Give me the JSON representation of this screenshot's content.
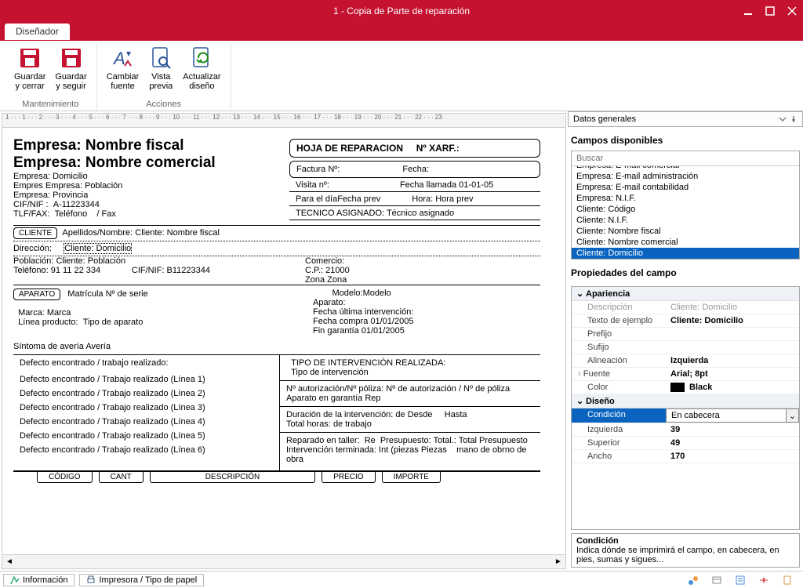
{
  "window": {
    "title": "1 - Copia de Parte de reparación"
  },
  "tabs": {
    "designer": "Diseñador"
  },
  "ribbon": {
    "groups": {
      "mantenimiento": {
        "label": "Mantenimiento",
        "save_close": "Guardar\ny cerrar",
        "save_continue": "Guardar\ny seguir"
      },
      "acciones": {
        "label": "Acciones",
        "change_font": "Cambiar\nfuente",
        "preview": "Vista\nprevia",
        "refresh": "Actualizar\ndiseño"
      }
    }
  },
  "ruler": "1 · · · 1 · · · 2 · · · 3 · · · 4 · · · 5 · · · 6 · · · 7 · · · 8 · · · 9 · · · 10 · · · 11 · · · 12 · · · 13 · · · 14 · · · 15 · · · 16 · · · 17 · · · 18 · · · 19 · · · 20 · · · 21 · · · 22 · · · 23",
  "report": {
    "company": {
      "fiscal": "Empresa: Nombre fiscal",
      "commercial": "Empresa: Nombre comercial",
      "domicilio": "Empresa: Domicilio",
      "poblacion": "Empres Empresa: Población",
      "provincia": "Empresa: Provincia",
      "cif_label": "CIF/NIF :",
      "cif_value": "A-11223344",
      "tlf_label": "TLF/FAX:",
      "tlf_value": "Teléfono",
      "fax_sep": "/ Fax"
    },
    "hoja": {
      "title": "HOJA DE REPARACION",
      "num": "Nº XARF.:"
    },
    "factura": {
      "num_label": "Factura Nº:",
      "fecha_label": "Fecha:"
    },
    "visita": {
      "num_label": "Visita nº:",
      "llamada_label": "Fecha llamada",
      "llamada_val": "01-01-05",
      "dia_label": "Para el día",
      "dia_val": "Fecha prev",
      "hora_label": "Hora:",
      "hora_val": "Hora prev",
      "tecnico_label": "TECNICO ASIGNADO:",
      "tecnico_val": "Técnico asignado"
    },
    "cliente": {
      "hdr": "CLIENTE",
      "nombre_label": "Apellidos/Nombre:",
      "nombre_val": "Cliente: Nombre fiscal",
      "dir_label": "Dirección:",
      "dir_val": "Cliente: Domicilio",
      "pob_label": "Población:",
      "pob_val": "Cliente: Población",
      "tel_label": "Teléfono:",
      "tel_val": "91 11 22 334",
      "cif_label": "CIF/NIF:",
      "cif_val": "B11223344",
      "right": {
        "comercio_label": "Comercio:",
        "cp_label": "C.P.:",
        "cp_val": "21000",
        "zona_label": "Zona",
        "zona_val": "Zona"
      }
    },
    "aparato": {
      "hdr": "APARATO",
      "matricula": "Matrícula Nº de serie",
      "modelo_l": "Modelo:",
      "modelo_v": "Modelo",
      "marca_l": "Marca:",
      "marca_v": "Marca",
      "aparato_l": "Aparato:",
      "linea_l": "Línea producto:",
      "linea_v": "Tipo de aparato",
      "ultima_l": "Fecha última intervención:",
      "compra_l": "Fecha compra",
      "compra_v": "01/01/2005",
      "fin_l": "Fin garantía",
      "fin_v": "01/01/2005",
      "sintoma_l": "Síntoma de avería",
      "sintoma_v": "Avería"
    },
    "defecto": {
      "defecto_hdr": "Defecto encontrado / trabajo realizado:",
      "tipo_hdr": "TIPO DE INTERVENCIÓN REALIZADA:",
      "tipo_val": "Tipo de intervención",
      "lines": [
        "Defecto encontrado / Trabajo realizado (Línea 1)",
        "Defecto encontrado / Trabajo realizado (Línea 2)",
        "Defecto encontrado / Trabajo realizado (Línea 3)",
        "Defecto encontrado / Trabajo realizado (Línea 4)",
        "Defecto encontrado / Trabajo realizado (Línea 5)",
        "Defecto encontrado / Trabajo realizado (Línea 6)"
      ],
      "auth_l": "Nº autorización/Nº póliza:",
      "auth_v": "Nº de autorización / Nº de póliza",
      "garantia_l": "Aparato en garantía",
      "garantia_v": "Rep",
      "dur_l": "Duración de la intervención:",
      "dur_v1": "de Desde",
      "dur_v2": "Hasta",
      "horas_l": "Total horas:",
      "horas_v": "de trabajo",
      "rep_l": "Reparado en taller:",
      "rep_v": "Re",
      "presu_l": "Presupuesto:",
      "presu_v": "Total.: Total Presupuesto",
      "term_l": "Intervención terminada:",
      "term_v": "Int (piezas Piezas",
      "term_v2": "mano de obrno de obra",
      "col_headers": [
        "CÓDIGO",
        "CANT",
        "DESCRIPCIÓN",
        "PRECIO",
        "IMPORTE"
      ]
    }
  },
  "panel": {
    "header": "Datos generales",
    "fields_title": "Campos disponibles",
    "search_placeholder": "Buscar",
    "fields": [
      "Empresa: E-mail comercial",
      "Empresa: E-mail administración",
      "Empresa: E-mail contabilidad",
      "Empresa: N.I.F.",
      "Cliente: Código",
      "Cliente: N.I.F.",
      "Cliente: Nombre fiscal",
      "Cliente: Nombre comercial",
      "Cliente: Domicilio"
    ],
    "fields_selected_index": 8,
    "props_title": "Propiedades del campo",
    "props": {
      "apariencia": "Apariencia",
      "descripcion_k": "Descripción",
      "descripcion_v": "Cliente: Domicilio",
      "ejemplo_k": "Texto de ejemplo",
      "ejemplo_v": "Cliente: Domicilio",
      "prefijo_k": "Prefijo",
      "sufijo_k": "Sufijo",
      "alineacion_k": "Alineación",
      "alineacion_v": "Izquierda",
      "fuente_k": "Fuente",
      "fuente_v": "Arial; 8pt",
      "color_k": "Color",
      "color_v": "Black",
      "diseno": "Diseño",
      "condicion_k": "Condición",
      "condicion_v": "En cabecera",
      "izquierda_k": "Izquierda",
      "izquierda_v": "39",
      "superior_k": "Superior",
      "superior_v": "49",
      "ancho_k": "Ancho",
      "ancho_v": "170"
    },
    "help": {
      "title": "Condición",
      "text": "Indica dónde se imprimirá el campo, en cabecera, en pies, sumas y sigues..."
    }
  },
  "status": {
    "info": "Información",
    "printer": "Impresora / Tipo de papel"
  }
}
